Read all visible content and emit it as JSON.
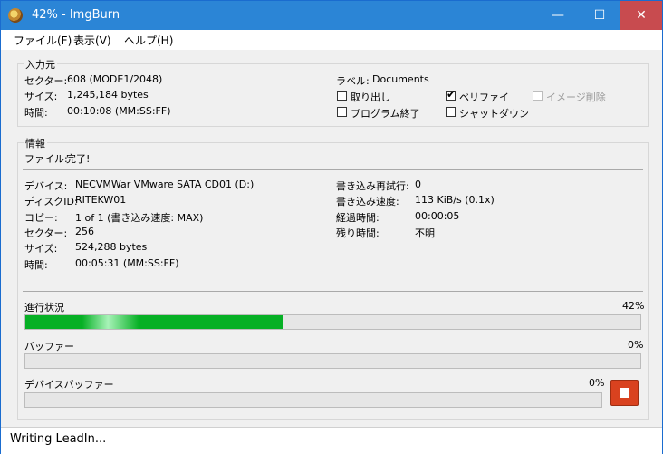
{
  "window": {
    "title": "42% - ImgBurn",
    "minimize": "—",
    "maximize": "☐",
    "close": "✕"
  },
  "menu": {
    "file": "ファイル(F)",
    "view": "表示(V)",
    "help": "ヘルプ(H)"
  },
  "source": {
    "title": "入力元",
    "sector_label": "セクター:",
    "sector_value": "608 (MODE1/2048)",
    "size_label": "サイズ:",
    "size_value": "1,245,184 bytes",
    "time_label": "時間:",
    "time_value": "00:10:08 (MM:SS:FF)",
    "volume_label": "ラベル:",
    "volume_value": "Documents",
    "eject": "取り出し",
    "verify": "ベリファイ",
    "delete_image": "イメージ削除",
    "close_program": "プログラム終了",
    "shutdown": "シャットダウン"
  },
  "info": {
    "title": "情報",
    "file_label": "ファイル:",
    "file_value": "完了!",
    "device_label": "デバイス:",
    "device_value": "NECVMWar VMware SATA CD01 (D:)",
    "disc_id_label": "ディスクID:",
    "disc_id_value": "RITEKW01",
    "copy_label": "コピー:",
    "copy_value": "1 of 1 (書き込み速度: MAX)",
    "sector_label": "セクター:",
    "sector_value": "256",
    "size_label": "サイズ:",
    "size_value": "524,288 bytes",
    "time_label": "時間:",
    "time_value": "00:05:31 (MM:SS:FF)",
    "retries_label": "書き込み再試行:",
    "retries_value": "0",
    "speed_label": "書き込み速度:",
    "speed_value": "113 KiB/s (0.1x)",
    "elapsed_label": "経過時間:",
    "elapsed_value": "00:00:05",
    "remaining_label": "残り時間:",
    "remaining_value": "不明"
  },
  "progress": {
    "label": "進行状況",
    "percent_text": "42%",
    "fraction": 0.42,
    "buffer_label": "バッファー",
    "buffer_text": "0%",
    "buffer_fraction": 0,
    "device_buffer_label": "デバイスバッファー",
    "device_buffer_text": "0%",
    "device_buffer_fraction": 0
  },
  "status": {
    "text": "Writing LeadIn..."
  },
  "colors": {
    "progress": "#06b025",
    "stop": "#d9421f",
    "titlebar": "#2b85d6"
  }
}
